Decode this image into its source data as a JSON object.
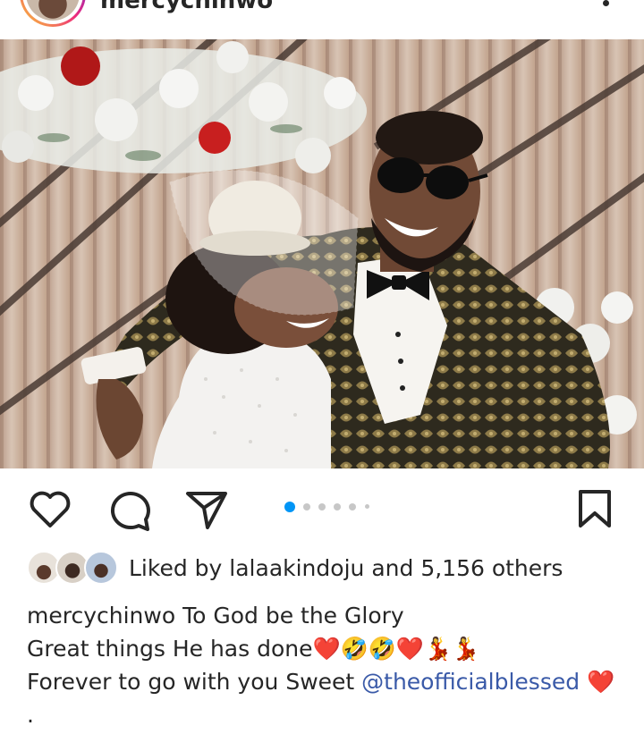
{
  "post": {
    "username": "mercychinwo",
    "likes_prefix": "Liked by",
    "liked_by_user": "lalaakindoju",
    "likes_middle": "and",
    "likes_count": "5,156 others",
    "caption_lines": [
      "To God be the Glory",
      "Great things He has done",
      "Forever to go with you Sweet",
      "."
    ],
    "caption_emojis_line2": "❤️🤣🤣❤️💃💃",
    "caption_mention": "@theofficialblessed",
    "caption_emoji_line3": "❤️",
    "carousel": {
      "total": 6,
      "active_index": 0
    }
  },
  "icons": {
    "like": "heart-outline-icon",
    "comment": "comment-bubble-icon",
    "share": "paper-plane-icon",
    "save": "bookmark-icon",
    "more": "more-options-icon"
  },
  "colors": {
    "text": "#262626",
    "mention": "#3a5aa8",
    "dot_active": "#0095f6",
    "dot_inactive": "#c7c7c7",
    "heart": "#e0245e"
  }
}
